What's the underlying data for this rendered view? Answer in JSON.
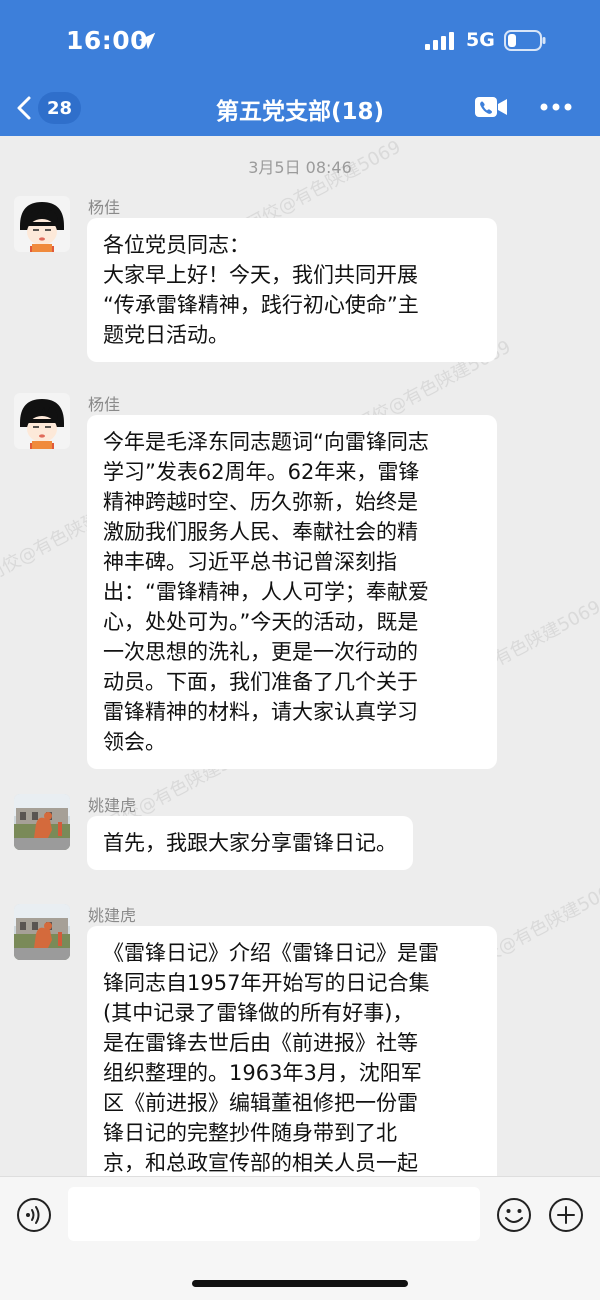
{
  "status_bar": {
    "time": "16:00",
    "network": "5G"
  },
  "nav": {
    "back_count": "28",
    "title": "第五党支部(18)"
  },
  "chat": {
    "timestamp": "3月5日 08:46",
    "messages": [
      {
        "sender": "杨佳",
        "text": "各位党员同志：\n大家早上好！今天，我们共同开展\n“传承雷锋精神，践行初心使命”主\n题党日活动。"
      },
      {
        "sender": "杨佳",
        "text": "今年是毛泽东同志题词“向雷锋同志\n学习”发表62周年。62年来，雷锋\n精神跨越时空、历久弥新，始终是\n激励我们服务人民、奉献社会的精\n神丰碑。习近平总书记曾深刻指\n出：“雷锋精神，人人可学；奉献爱\n心，处处可为。”今天的活动，既是\n一次思想的洗礼，更是一次行动的\n动员。下面，我们准备了几个关于\n雷锋精神的材料，请大家认真学习\n领会。"
      },
      {
        "sender": "姚建虎",
        "text": "首先，我跟大家分享雷锋日记。"
      },
      {
        "sender": "姚建虎",
        "text": "《雷锋日记》介绍《雷锋日记》是雷\n锋同志自1957年开始写的日记合集\n(其中记录了雷锋做的所有好事)，\n是在雷锋去世后由《前进报》社等\n组织整理的。1963年3月，沈阳军\n区《前进报》编辑董祖修把一份雷\n锋日记的完整抄件随身带到了北\n京，和总政宣传部的相关人员一起"
      }
    ],
    "watermarks": [
      "张珂佼@有色陕建5069",
      "张珂佼@有色陕建5069",
      "张珂佼@有色陕建5069",
      "张珂佼@有色陕建5069",
      "张珂佼@有色陕建5069",
      "张珂佼@有色陕建5069"
    ]
  },
  "input": {
    "placeholder": ""
  },
  "colors": {
    "header": "#3d7fda",
    "background": "#ededed",
    "bubble": "#ffffff"
  }
}
